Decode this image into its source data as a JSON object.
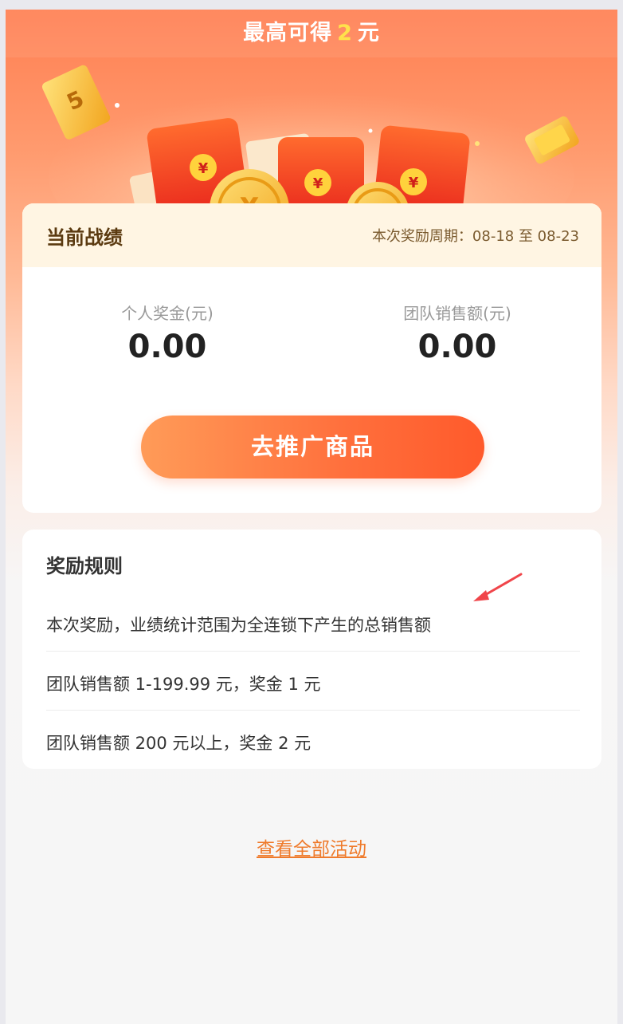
{
  "banner": {
    "title_prefix": "最高可得",
    "amount": "2",
    "title_suffix": "元"
  },
  "stats_card": {
    "title": "当前战绩",
    "period": "本次奖励周期：08-18 至 08-23",
    "personal_label": "个人奖金(元)",
    "personal_value": "0.00",
    "team_label": "团队销售额(元)",
    "team_value": "0.00",
    "cta_label": "去推广商品"
  },
  "rules_card": {
    "title": "奖励规则",
    "rules": [
      "本次奖励，业绩统计范围为全连锁下产生的总销售额",
      "团队销售额 1-199.99 元，奖金 1 元",
      "团队销售额 200 元以上，奖金 2 元"
    ]
  },
  "footer": {
    "link": "查看全部活动"
  },
  "hero_decor": {
    "coupon_text": "5",
    "currency_symbol": "¥"
  },
  "colors": {
    "accent": "#ff6f3c",
    "link": "#ef7b2c",
    "amount": "#ffe14b"
  }
}
